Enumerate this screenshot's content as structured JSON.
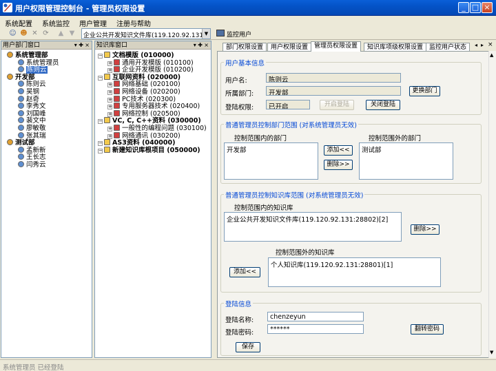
{
  "window": {
    "title": "用户权限管理控制台 - 管理员权限设置"
  },
  "menu": [
    "系统配置",
    "系统监控",
    "用户管理",
    "注册与帮助"
  ],
  "toolbar": {
    "combo_value": "企业公共开发知识文件库(119.120.92.131:",
    "monitor_label": "监控用户"
  },
  "left_pane": {
    "title": "用户部门窗口",
    "tree": [
      {
        "label": "系统管理部",
        "level": 0,
        "bold": true
      },
      {
        "label": "系统管理员",
        "level": 1
      },
      {
        "label": "陈则云",
        "level": 1,
        "selected": true
      },
      {
        "label": "开发部",
        "level": 0,
        "bold": true
      },
      {
        "label": "陈则云",
        "level": 1
      },
      {
        "label": "吴钢",
        "level": 1
      },
      {
        "label": "赵奇",
        "level": 1
      },
      {
        "label": "李秀文",
        "level": 1
      },
      {
        "label": "刘国峰",
        "level": 1
      },
      {
        "label": "裴文中",
        "level": 1
      },
      {
        "label": "廖敏敬",
        "level": 1
      },
      {
        "label": "张其瑞",
        "level": 1
      },
      {
        "label": "测试部",
        "level": 0,
        "bold": true
      },
      {
        "label": "孟新新",
        "level": 1
      },
      {
        "label": "王长志",
        "level": 1
      },
      {
        "label": "闫秀云",
        "level": 1
      }
    ]
  },
  "mid_pane": {
    "title": "知识库窗口",
    "tree": [
      {
        "label": "文档模版 (010000)",
        "level": 0,
        "bold": true
      },
      {
        "label": "通用开发模版 (010100)",
        "level": 1
      },
      {
        "label": "企业开发模版 (010200)",
        "level": 1
      },
      {
        "label": "互联网资料 (020000)",
        "level": 0,
        "bold": true
      },
      {
        "label": "网络基础 (020100)",
        "level": 1
      },
      {
        "label": "网络设备 (020200)",
        "level": 1
      },
      {
        "label": "PC技术 (020300)",
        "level": 1
      },
      {
        "label": "专用服务器技术 (020400)",
        "level": 1
      },
      {
        "label": "网络控制 (020500)",
        "level": 1
      },
      {
        "label": "VC, C, C++资料 (030000)",
        "level": 0,
        "bold": true
      },
      {
        "label": "一般性的编程问题 (030100)",
        "level": 1
      },
      {
        "label": "网络通讯 (030200)",
        "level": 1
      },
      {
        "label": "AS3资料 (040000)",
        "level": 0,
        "bold": true
      },
      {
        "label": "新建知识库根项目 (050000)",
        "level": 0,
        "bold": true
      }
    ]
  },
  "tabs": [
    {
      "label": "部门权限设置"
    },
    {
      "label": "用户权限设置"
    },
    {
      "label": "管理员权限设置",
      "active": true
    },
    {
      "label": "知识库项级权限设置"
    },
    {
      "label": "监控用户状态"
    }
  ],
  "basic_info": {
    "title": "用户基本信息",
    "username_label": "用户名:",
    "username": "陈则云",
    "dept_label": "所属部门:",
    "dept": "开发部",
    "change_dept_btn": "更换部门",
    "login_perm_label": "登陆权限:",
    "login_perm": "已开启",
    "open_login_btn": "开启登陆",
    "close_login_btn": "关闭登陆"
  },
  "dept_scope": {
    "title": "普通管理员控制部门范围 (对系统管理员无效)",
    "in_label": "控制范围内的部门",
    "out_label": "控制范围外的部门",
    "in_items": [
      "开发部"
    ],
    "out_items": [
      "测试部"
    ],
    "add_btn": "添加<<",
    "del_btn": "删除>>"
  },
  "kb_scope": {
    "title": "普通管理员控制知识库范围 (对系统管理员无效)",
    "in_label": "控制范围内的知识库",
    "in_items": [
      "企业公共开发知识文件库(119.120.92.131:28802)[2]"
    ],
    "del_btn": "删除>>",
    "out_label": "控制范围外的知识库",
    "out_items": [
      "个人知识库(119.120.92.131:28801)[1]"
    ],
    "add_btn": "添加<<"
  },
  "login_info": {
    "title": "登陆信息",
    "login_name_label": "登陆名称:",
    "login_name": "chenzeyun",
    "password_label": "登陆密码:",
    "password": "******",
    "flip_btn": "翻转密码",
    "save_btn": "保存"
  },
  "status": "系统管理员 已经登陆"
}
